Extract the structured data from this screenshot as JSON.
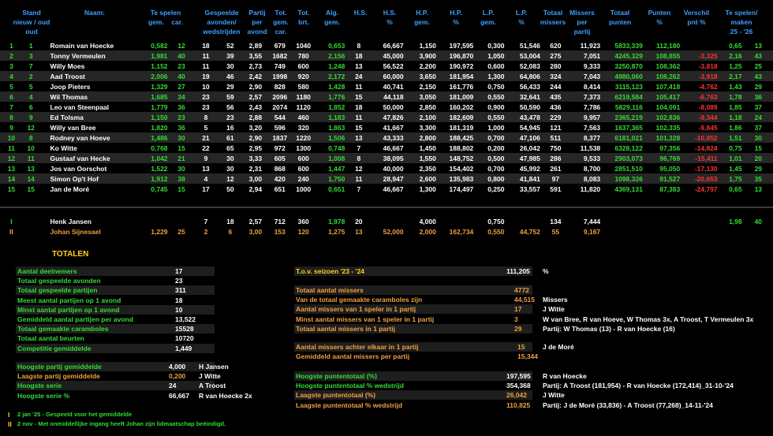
{
  "headers": {
    "stand": "Stand\nnieuw / oud\noud",
    "naam": "Naam:",
    "te_spelen": "Te spelen\ngem.    car.",
    "gespeelde": "Gespeelde\navonden/\nwedstrijden",
    "partij": "Partij\nper\navond",
    "tot_gem": "Tot.\ngem.\ncar.",
    "tot_brt": "Tot.\nbrt.",
    "alg": "Alg.\ngem.",
    "hs": "H.S.",
    "hs_pct": "H.S.\n%",
    "hp_gem": "H.P.\ngem.",
    "hp_pct": "H.P.\n%",
    "lp_gem": "L.P.\ngem.",
    "lp_pct": "L.P.\n%",
    "totaal_missers": "Totaal\nmissers",
    "missers_per": "Missers\nper\npartij",
    "totaal_punten": "Totaal\npunten",
    "punten_pct": "Punten\n%",
    "verschil": "Verschil\npnt %",
    "te_spelen_maken": "Te spelen/\nmaken\n25 - '26"
  },
  "rows": [
    [
      "1",
      "1",
      "Romain van Hoecke",
      "0,582",
      "12",
      "18",
      "52",
      "2,89",
      "679",
      "1040",
      "0,653",
      "8",
      "66,667",
      "1,150",
      "197,595",
      "0,300",
      "51,546",
      "620",
      "11,923",
      "5833,339",
      "112,180",
      "",
      "0,65",
      "13"
    ],
    [
      "2",
      "3",
      "Tonny Vermeulen",
      "1,981",
      "40",
      "11",
      "39",
      "3,55",
      "1682",
      "780",
      "2,156",
      "18",
      "45,000",
      "3,900",
      "196,870",
      "1,050",
      "53,004",
      "275",
      "7,051",
      "4245,329",
      "108,855",
      "-3,325",
      "2,16",
      "43"
    ],
    [
      "3",
      "7",
      "Willy Moes",
      "1,152",
      "23",
      "11",
      "30",
      "2,73",
      "749",
      "600",
      "1,248",
      "13",
      "56,522",
      "2,200",
      "190,972",
      "0,600",
      "52,083",
      "280",
      "9,333",
      "3250,870",
      "108,362",
      "-3,818",
      "1,25",
      "25"
    ],
    [
      "4",
      "2",
      "Aad Troost",
      "2,006",
      "40",
      "19",
      "46",
      "2,42",
      "1998",
      "920",
      "2,172",
      "24",
      "60,000",
      "3,650",
      "181,954",
      "1,300",
      "64,806",
      "324",
      "7,043",
      "4980,060",
      "108,262",
      "-3,918",
      "2,17",
      "43"
    ],
    [
      "5",
      "5",
      "Joop Pieters",
      "1,329",
      "27",
      "10",
      "29",
      "2,90",
      "828",
      "580",
      "1,428",
      "11",
      "40,741",
      "2,150",
      "161,776",
      "0,750",
      "56,433",
      "244",
      "8,414",
      "3115,123",
      "107,418",
      "-4,762",
      "1,43",
      "29"
    ],
    [
      "6",
      "4",
      "Wil Thomas",
      "1,685",
      "34",
      "23",
      "59",
      "2,57",
      "2096",
      "1180",
      "1,776",
      "15",
      "44,118",
      "3,050",
      "181,009",
      "0,550",
      "32,641",
      "435",
      "7,373",
      "6219,584",
      "105,417",
      "-6,763",
      "1,78",
      "36"
    ],
    [
      "7",
      "6",
      "Leo van Steenpaal",
      "1,779",
      "36",
      "23",
      "56",
      "2,43",
      "2074",
      "1120",
      "1,852",
      "18",
      "50,000",
      "2,850",
      "160,202",
      "0,900",
      "50,590",
      "436",
      "7,786",
      "5829,116",
      "104,091",
      "-8,089",
      "1,85",
      "37"
    ],
    [
      "8",
      "9",
      "Ed Tolsma",
      "1,150",
      "23",
      "8",
      "23",
      "2,88",
      "544",
      "460",
      "1,183",
      "11",
      "47,826",
      "2,100",
      "182,609",
      "0,550",
      "43,478",
      "229",
      "9,957",
      "2365,219",
      "102,836",
      "-9,344",
      "1,18",
      "24"
    ],
    [
      "9",
      "12",
      "Willy van Bree",
      "1,820",
      "36",
      "5",
      "16",
      "3,20",
      "596",
      "320",
      "1,863",
      "15",
      "41,667",
      "3,300",
      "181,319",
      "1,000",
      "54,945",
      "121",
      "7,563",
      "1637,365",
      "102,335",
      "-9,845",
      "1,86",
      "37"
    ],
    [
      "10",
      "8",
      "Rodney van Hoeve",
      "1,486",
      "30",
      "21",
      "61",
      "2,90",
      "1837",
      "1220",
      "1,506",
      "13",
      "43,333",
      "2,800",
      "188,425",
      "0,700",
      "47,106",
      "511",
      "8,377",
      "6181,021",
      "101,328",
      "-10,852",
      "1,51",
      "30"
    ],
    [
      "11",
      "10",
      "Ko Witte",
      "0,768",
      "15",
      "22",
      "65",
      "2,95",
      "972",
      "1300",
      "0,748",
      "7",
      "46,667",
      "1,450",
      "188,802",
      "0,200",
      "26,042",
      "750",
      "11,538",
      "6328,122",
      "97,356",
      "-14,824",
      "0,75",
      "15"
    ],
    [
      "12",
      "11",
      "Gustaaf van Hecke",
      "1,042",
      "21",
      "9",
      "30",
      "3,33",
      "605",
      "600",
      "1,008",
      "8",
      "38,095",
      "1,550",
      "148,752",
      "0,500",
      "47,985",
      "286",
      "9,533",
      "2903,073",
      "96,769",
      "-15,411",
      "1,01",
      "20"
    ],
    [
      "13",
      "13",
      "Jos van Oorschot",
      "1,522",
      "30",
      "13",
      "30",
      "2,31",
      "868",
      "600",
      "1,447",
      "12",
      "40,000",
      "2,350",
      "154,402",
      "0,700",
      "45,992",
      "261",
      "8,700",
      "2851,510",
      "95,050",
      "-17,130",
      "1,45",
      "29"
    ],
    [
      "14",
      "14",
      "Simon Op't Hof",
      "1,912",
      "38",
      "4",
      "12",
      "3,00",
      "420",
      "240",
      "1,750",
      "11",
      "28,947",
      "2,600",
      "135,983",
      "0,800",
      "41,841",
      "97",
      "8,083",
      "1098,326",
      "91,527",
      "-20,653",
      "1,75",
      "35"
    ],
    [
      "15",
      "15",
      "Jan de Moré",
      "0,745",
      "15",
      "17",
      "50",
      "2,94",
      "651",
      "1000",
      "0,651",
      "7",
      "46,667",
      "1,300",
      "174,497",
      "0,250",
      "33,557",
      "591",
      "11,820",
      "4369,131",
      "87,383",
      "-24,797",
      "0,65",
      "13"
    ]
  ],
  "extra": [
    {
      "mark": "I",
      "name": "Henk Jansen",
      "gem": "",
      "car": "",
      "avonden": "7",
      "wed": "18",
      "partij": "2,57",
      "tot": "712",
      "brt": "360",
      "alg": "1,978",
      "hs": "20",
      "hs_pct": "",
      "hp": "4,000",
      "hp_pct": "",
      "lp": "0,750",
      "lp_pct": "",
      "miss": "134",
      "per": "7,444",
      "ts": "1,98",
      "tm": "40"
    },
    {
      "mark": "II",
      "name": "Johan Sijnesael",
      "gem": "1,229",
      "car": "25",
      "avonden": "2",
      "wed": "6",
      "partij": "3,00",
      "tot": "153",
      "brt": "120",
      "alg": "1,275",
      "hs": "13",
      "hs_pct": "52,000",
      "hp": "2,000",
      "hp_pct": "162,734",
      "lp": "0,550",
      "lp_pct": "44,752",
      "miss": "55",
      "per": "9,167",
      "ts": "",
      "tm": ""
    }
  ],
  "totalen": {
    "title": "TOTALEN",
    "left": [
      {
        "label": "Aantal deelnemers",
        "value": "17",
        "extra": "",
        "color": "green"
      },
      {
        "label": "Totaal gespeelde avonden",
        "value": "23",
        "extra": "",
        "color": "green"
      },
      {
        "label": "Totaal gespeelde partijen",
        "value": "311",
        "extra": "",
        "color": "green"
      },
      {
        "label": "Meest aantal partijen op 1 avond",
        "value": "18",
        "extra": "",
        "color": "green"
      },
      {
        "label": "Minst aantal partijen op 1 avond",
        "value": "10",
        "extra": "",
        "color": "green"
      },
      {
        "label": "Gemiddeld aantal partijen per avond",
        "value": "13,522",
        "extra": "",
        "color": "green"
      },
      {
        "label": "Totaal gemaakte caramboles",
        "value": "15528",
        "extra": "",
        "color": "green"
      },
      {
        "label": "Totaal aantal beurten",
        "value": "10720",
        "extra": "",
        "color": "green"
      },
      {
        "label": "Competitie gemiddelde",
        "value": "1,449",
        "extra": "",
        "color": "green"
      }
    ],
    "left2": [
      {
        "label": "Hoogste partij gemiddelde",
        "value": "4,000",
        "extra": "H Jansen",
        "color": "green"
      },
      {
        "label": "Laagste partij gemiddelde",
        "value": "0,200",
        "extra": "J Witte",
        "color": "orange"
      },
      {
        "label": "Hoogste serie",
        "value": "24",
        "extra": "A Troost",
        "color": "green"
      },
      {
        "label": "Hoogste serie %",
        "value": "66,667",
        "extra": "R van Hoecke 2x",
        "color": "green"
      }
    ],
    "right_top": {
      "label": "T.o.v. seizoen '23 - '24",
      "value": "111,205",
      "extra": "%"
    },
    "right": [
      {
        "label": "Totaal aantal missers",
        "value": "4772",
        "extra": "",
        "color": "orange"
      },
      {
        "label": "Van de totaal gemaakte caramboles zijn",
        "value": "44,515",
        "extra": "Missers",
        "color": "orange"
      },
      {
        "label": "Aantal missers van 1 speler in 1 partij",
        "value": "17",
        "extra": "J Witte",
        "color": "orange"
      },
      {
        "label": "Minst aantal missers van 1 speler in 1 partij",
        "value": "3",
        "extra": "W van Bree, R van Hoeve, W Thomas 3x, A Troost, T Vermeulen 3x",
        "color": "orange"
      },
      {
        "label": "Totaal aantal missers in 1 partij",
        "value": "29",
        "extra": "Partij: W Thomas (13) - R van Hoecke (16)",
        "color": "orange"
      }
    ],
    "right2": [
      {
        "label": "Aantal missers achter elkaar in 1 partij",
        "value": "15",
        "extra": "J de Moré",
        "color": "orange"
      },
      {
        "label": "Gemiddeld aantal missers per partij",
        "value": "15,344",
        "extra": "",
        "color": "orange"
      }
    ],
    "right3": [
      {
        "label": "Hoogste puntentotaal (%)",
        "value": "197,595",
        "extra": "R van Hoecke",
        "color": "green"
      },
      {
        "label": "Hoogste puntentotaal % wedstrijd",
        "value": "354,368",
        "extra": "Partij: A Troost (181,954) - R van Hoecke (172,414)_31-10-'24",
        "color": "green"
      },
      {
        "label": "Laagste puntentotaal (%)",
        "value": "26,042",
        "extra": "J Witte",
        "color": "orange"
      },
      {
        "label": "Laagste puntentotaal % wedstrijd",
        "value": "110,825",
        "extra": "Partij: J de Moré (33,836) - A Troost (77,268)_14-11-'24",
        "color": "orange"
      }
    ]
  },
  "footnotes": [
    {
      "mark": "I",
      "text": "2 jan '25 - Gespeeld voor het gemiddelde"
    },
    {
      "mark": "II",
      "text": "2 nov - Met onmiddellijke ingang heeft Johan zijn lidmaatschap beëindigd."
    }
  ]
}
